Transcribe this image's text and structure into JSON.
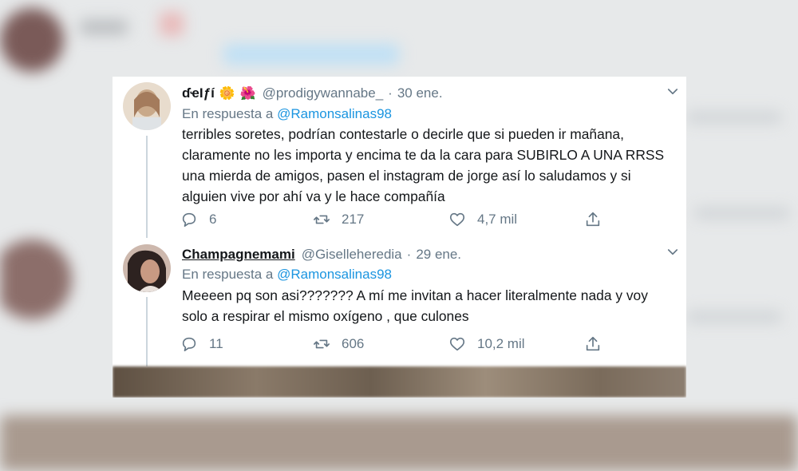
{
  "tweets": [
    {
      "display_name": "ɗҽӀƒí",
      "emoji_1": "🌼",
      "emoji_2": "🌺",
      "handle": "@prodigywannabe_",
      "dot": "·",
      "date": "30 ene.",
      "reply_prefix": "En respuesta a",
      "reply_mention": "@Ramonsalinas98",
      "text": "terribles soretes, podrían contestarle o decirle que si pueden ir mañana,\nclaramente no les importa y encima te da la cara para SUBIRLO A UNA RRSS\nuna mierda de amigos, pasen el instagram de jorge así lo saludamos y si\nalguien vive por ahí va y le hace compañía",
      "replies": "6",
      "retweets": "217",
      "likes": "4,7 mil",
      "avatar_colors": [
        "#d9c6b0",
        "#b79a7e"
      ]
    },
    {
      "display_name": "Champagnemami",
      "handle": "@Giselleheredia",
      "dot": "·",
      "date": "29 ene.",
      "reply_prefix": "En respuesta a",
      "reply_mention": "@Ramonsalinas98",
      "text": "Meeeen pq son asi??????? A mí me invitan a hacer literalmente nada y voy\nsolo a respirar el mismo oxígeno , que culones",
      "replies": "11",
      "retweets": "606",
      "likes": "10,2 mil",
      "avatar_colors": [
        "#6b4e45",
        "#2b211f"
      ]
    }
  ],
  "icons": {
    "reply": "reply-icon",
    "retweet": "retweet-icon",
    "like": "heart-icon",
    "share": "share-icon",
    "more": "chevron-down-icon"
  },
  "colors": {
    "mention": "#1b95e0",
    "muted": "#657786",
    "text": "#14171a"
  }
}
